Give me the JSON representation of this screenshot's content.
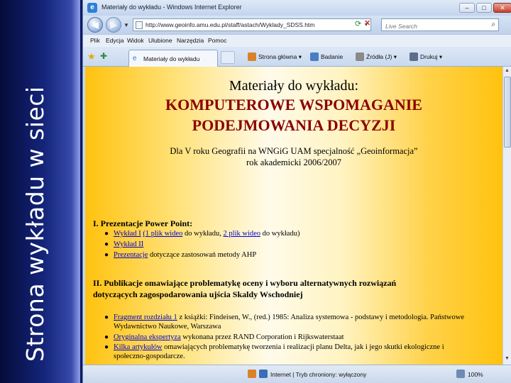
{
  "slide": {
    "vertical_title": "Strona wykładu w sieci"
  },
  "window": {
    "title": "Materiały do wykładu - Windows Internet Explorer"
  },
  "nav": {
    "url": "http://www.geoinfo.amu.edu.pl/staff/astach/Wyklady_SDSS.htm",
    "search_placeholder": "Live Search"
  },
  "menu": [
    "Plik",
    "Edycja",
    "Widok",
    "Ulubione",
    "Narzędzia",
    "Pomoc"
  ],
  "tabs": {
    "active_label": "Materiały do wykładu"
  },
  "toolbar": {
    "home": "Strona główna",
    "research": "Badanie",
    "feeds": "Źródła (J)",
    "print": "Drukuj"
  },
  "page": {
    "heading_1": "Materiały do wykładu:",
    "heading_2": "KOMPUTEROWE WSPOMAGANIE",
    "heading_3": "PODEJMOWANIA DECYZJI",
    "subtitle_1": "Dla V roku Geografii na WNGiG UAM specjalność „Geoinformacja”",
    "subtitle_2": "rok akademicki 2006/2007",
    "section_1": {
      "title": "I. Prezentacje Power Point:",
      "b1_link1": "Wykład I",
      "b1_link2": "(1 plik wideo",
      "b1_text1": " do wykładu, ",
      "b1_link3": "2 plik wideo",
      "b1_text2": " do wykładu)",
      "b2_link": "Wykład II",
      "b3_link": "Prezentacje",
      "b3_text": " dotyczące zastosowań metody AHP"
    },
    "section_2": {
      "title_line1": "II. Publikacje omawiające problematykę oceny i wyboru alternatywnych rozwiązań",
      "title_line2": "dotyczących zagospodarowania ujścia Skaldy Wschodniej",
      "b1_link": "Fragment rozdziału 1",
      "b1_text": " z książki: Findeisen, W., (red.) 1985: Analiza systemowa - podstawy i metodologia. Państwowe",
      "b1_text_line2": "Wydawnictwo Naukowe, Warszawa",
      "b2_link": "Oryginalna ekspertyza",
      "b2_text": " wykonana przez RAND Corporation i Rijkswaterstaat",
      "b3_link": "Kilka artykułów",
      "b3_text": " omawiających problematykę tworzenia i realizacji planu Delta, jak i jego skutki ekologiczne i",
      "b3_text_line2": "społeczno-gospodarcze."
    }
  },
  "status": {
    "zone": "Internet | Tryb chroniony: wyłączony",
    "zoom": "100%"
  }
}
